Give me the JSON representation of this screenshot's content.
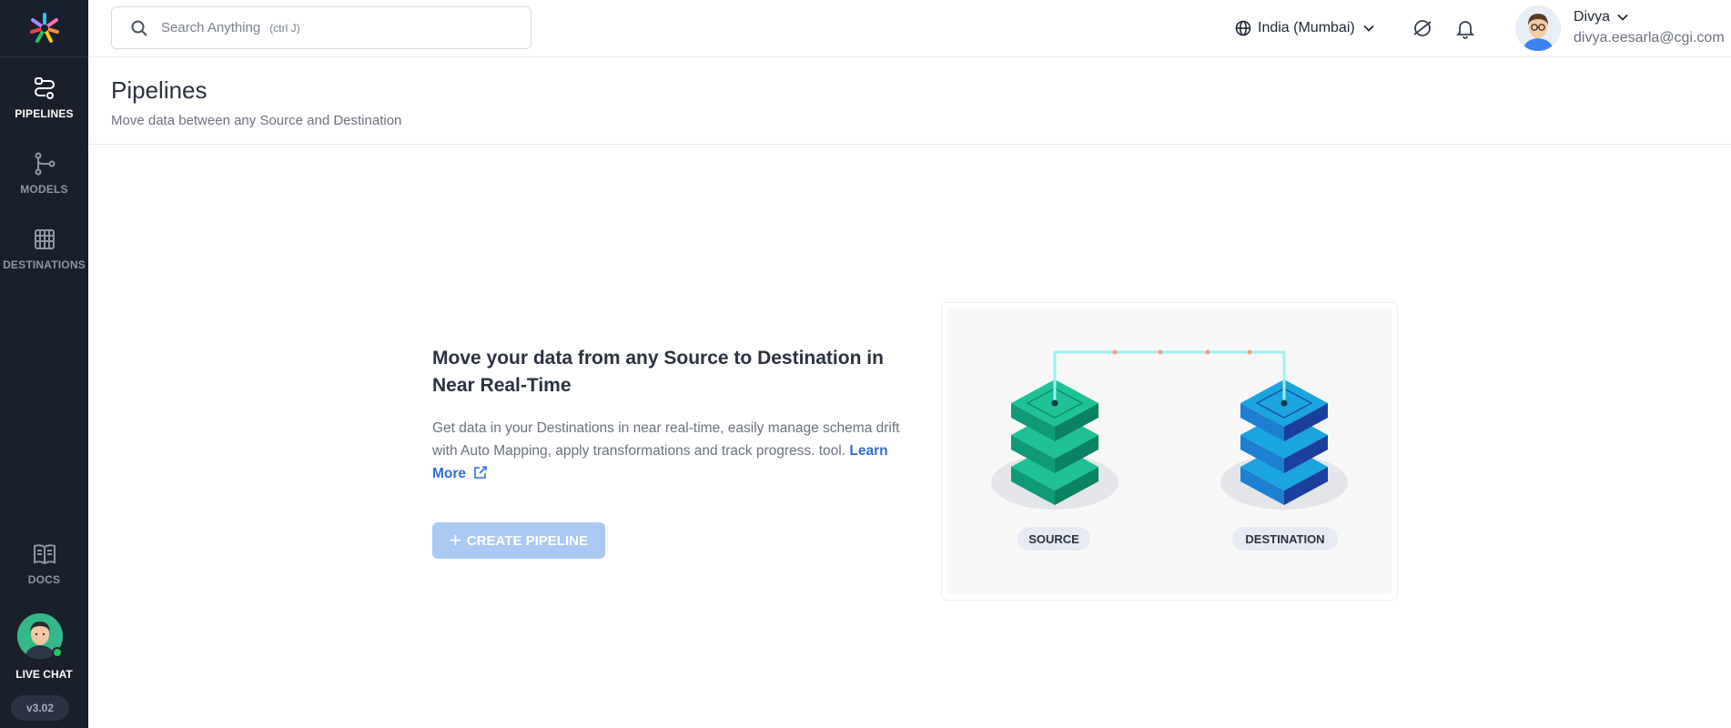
{
  "sidebar": {
    "items": [
      {
        "label": "PIPELINES",
        "icon": "pipelines-icon",
        "active": true
      },
      {
        "label": "MODELS",
        "icon": "models-icon",
        "active": false
      },
      {
        "label": "DESTINATIONS",
        "icon": "destinations-icon",
        "active": false
      }
    ],
    "docs_label": "DOCS",
    "live_chat_label": "LIVE CHAT",
    "version": "v3.02"
  },
  "topbar": {
    "search_placeholder": "Search Anything",
    "search_shortcut": "(ctrl J)",
    "region": "India (Mumbai)",
    "user_name": "Divya",
    "user_email": "divya.eesarla@cgi.com"
  },
  "page": {
    "title": "Pipelines",
    "subtitle": "Move data between any Source and Destination"
  },
  "empty_state": {
    "title": "Move your data from any Source to Destination in Near Real-Time",
    "body": "Get data in your Destinations in near real-time, easily manage schema drift with Auto Mapping, apply transformations and track progress. tool.",
    "learn_more": "Learn More",
    "create_button": "CREATE PIPELINE",
    "source_label": "SOURCE",
    "destination_label": "DESTINATION"
  },
  "colors": {
    "sidebar_bg": "#1a1f2c",
    "accent": "#2f6fd3",
    "button_disabled": "#a9c8f2",
    "source_green": "#17b38a",
    "destination_blue": "#1a8fd6"
  }
}
